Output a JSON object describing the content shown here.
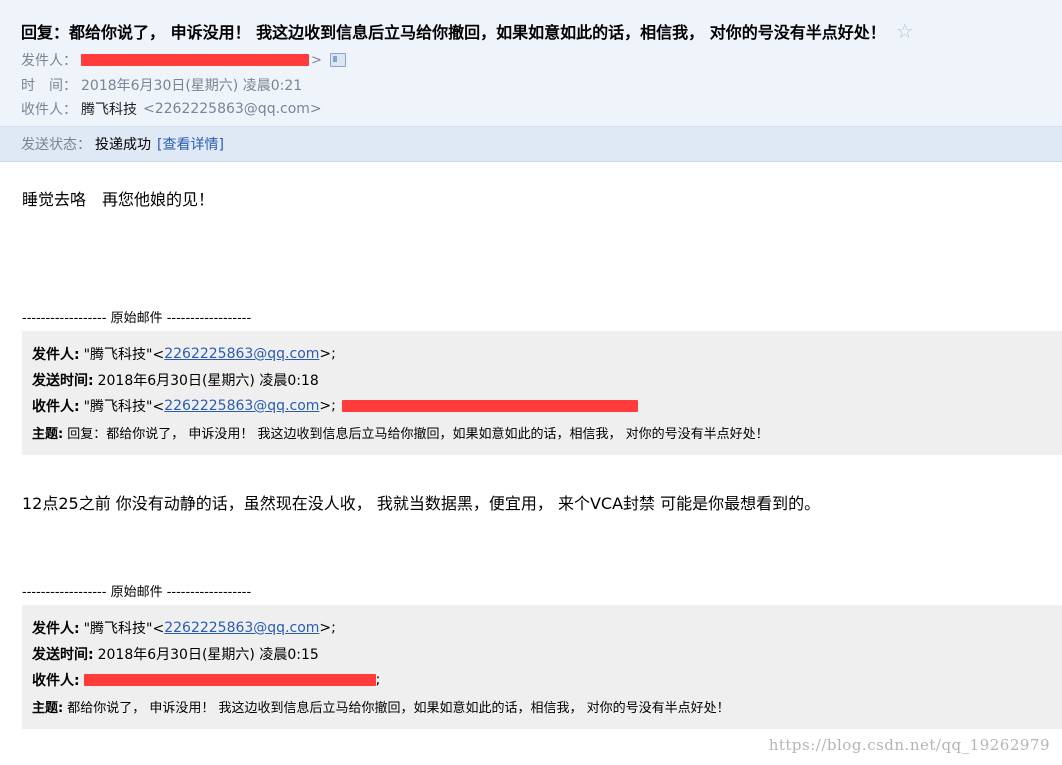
{
  "header": {
    "subject": "回复：都给你说了， 申诉没用！ 我这边收到信息后立马给你撤回，如果如意如此的话，相信我， 对你的号没有半点好处！",
    "sender_label": "发件人：",
    "sender_tail": ">",
    "time_label": "时　间：",
    "time_value": "2018年6月30日(星期六) 凌晨0:21",
    "recipient_label": "收件人：",
    "recipient_name": "腾飞科技",
    "recipient_email": "<2262225863@qq.com>"
  },
  "status": {
    "label": "发送状态：",
    "value": "投递成功",
    "details_link": "[查看详情]"
  },
  "body": {
    "reply_text": "睡觉去咯　再您他娘的见！",
    "second_text": "12点25之前 你没有动静的话，虽然现在没人收， 我就当数据黑，便宜用， 来个VCA封禁 可能是你最想看到的。"
  },
  "quote1": {
    "divider": "------------------ 原始邮件 ------------------",
    "from_label": "发件人:",
    "from_name": "\"腾飞科技\"<",
    "from_email": "2262225863@qq.com",
    "from_tail": ">;",
    "date_label": "发送时间:",
    "date_value": "2018年6月30日(星期六) 凌晨0:18",
    "to_label": "收件人:",
    "to_name": "\"腾飞科技\"<",
    "to_email": "2262225863@qq.com",
    "to_tail": ">;",
    "subject_label": "主题:",
    "subject_value": "回复：都给你说了， 申诉没用！ 我这边收到信息后立马给你撤回，如果如意如此的话，相信我， 对你的号没有半点好处！"
  },
  "quote2": {
    "divider": "------------------ 原始邮件 ------------------",
    "from_label": "发件人:",
    "from_name": "\"腾飞科技\"<",
    "from_email": "2262225863@qq.com",
    "from_tail": ">;",
    "date_label": "发送时间:",
    "date_value": "2018年6月30日(星期六) 凌晨0:15",
    "to_label": "收件人:",
    "to_tail": ";",
    "subject_label": "主题:",
    "subject_value": "都给你说了， 申诉没用！ 我这边收到信息后立马给你撤回，如果如意如此的话，相信我， 对你的号没有半点好处！"
  },
  "watermark": "https://blog.csdn.net/qq_19262979",
  "colors": {
    "header_bg": "#eff4fb",
    "status_bg": "#dfe9f5",
    "link": "#2a5db0",
    "redaction": "#ff3b3b",
    "quote_bg": "#efefef"
  },
  "icons": {
    "star": "star-icon",
    "contact_card": "contact-card-icon"
  }
}
